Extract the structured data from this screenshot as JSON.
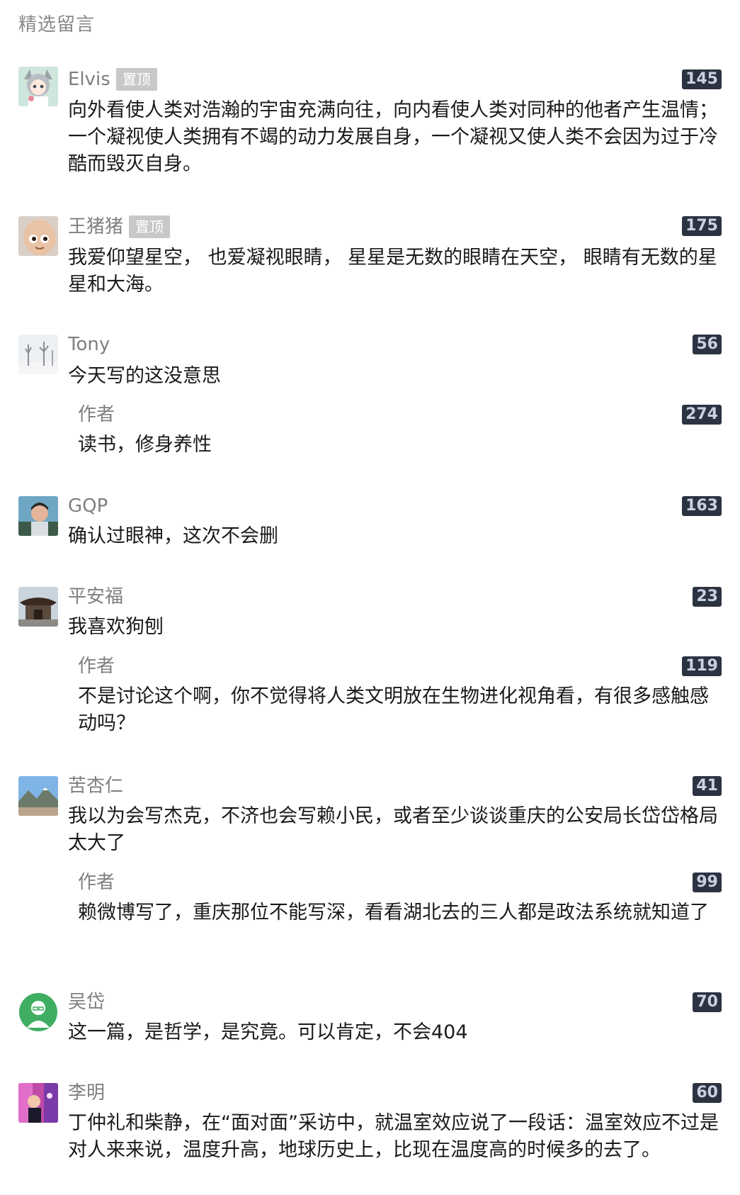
{
  "section_title": "精选留言",
  "pin_label": "置顶",
  "comments": [
    {
      "name": "Elvis",
      "pinned": true,
      "likes": "145",
      "text": "向外看使人类对浩瀚的宇宙充满向往，向内看使人类对同种的他者产生温情；一个凝视使人类拥有不竭的动力发展自身，一个凝视又使人类不会因为过于冷酷而毁灭自身。"
    },
    {
      "name": "王猪猪",
      "pinned": true,
      "likes": "175",
      "text": "我爱仰望星空，  也爱凝视眼睛，  星星是无数的眼睛在天空，  眼睛有无数的星星和大海。"
    },
    {
      "name": "Tony",
      "likes": "56",
      "text": "今天写的这没意思",
      "reply": {
        "name": "作者",
        "likes": "274",
        "text": "读书，修身养性"
      }
    },
    {
      "name": "GQP",
      "likes": "163",
      "text": "确认过眼神，这次不会删"
    },
    {
      "name": "平安福",
      "likes": "23",
      "text": "我喜欢狗刨",
      "reply": {
        "name": "作者",
        "likes": "119",
        "text": "不是讨论这个啊，你不觉得将人类文明放在生物进化视角看，有很多感触感动吗？"
      }
    },
    {
      "name": "苦杏仁",
      "likes": "41",
      "text": "我以为会写杰克，不济也会写赖小民，或者至少谈谈重庆的公安局长岱岱格局太大了",
      "reply": {
        "name": "作者",
        "likes": "99",
        "text": "赖微博写了，重庆那位不能写深，看看湖北去的三人都是政法系统就知道了"
      }
    },
    {
      "name": "吴岱",
      "likes": "70",
      "text": "这一篇，是哲学，是究竟。可以肯定，不会404"
    },
    {
      "name": "李明",
      "likes": "60",
      "text": "丁仲礼和柴静，在“面对面”采访中，就温室效应说了一段话：温室效应不过是对人来来说，温度升高，地球历史上，比现在温度高的时候多的去了。"
    }
  ],
  "avatar_icons": [
    "anime-girl-avatar",
    "cartoon-face-avatar",
    "snowy-trees-avatar",
    "man-portrait-avatar",
    "temple-roof-avatar",
    "mountain-landscape-avatar",
    "green-character-avatar",
    "colorful-photo-avatar"
  ]
}
